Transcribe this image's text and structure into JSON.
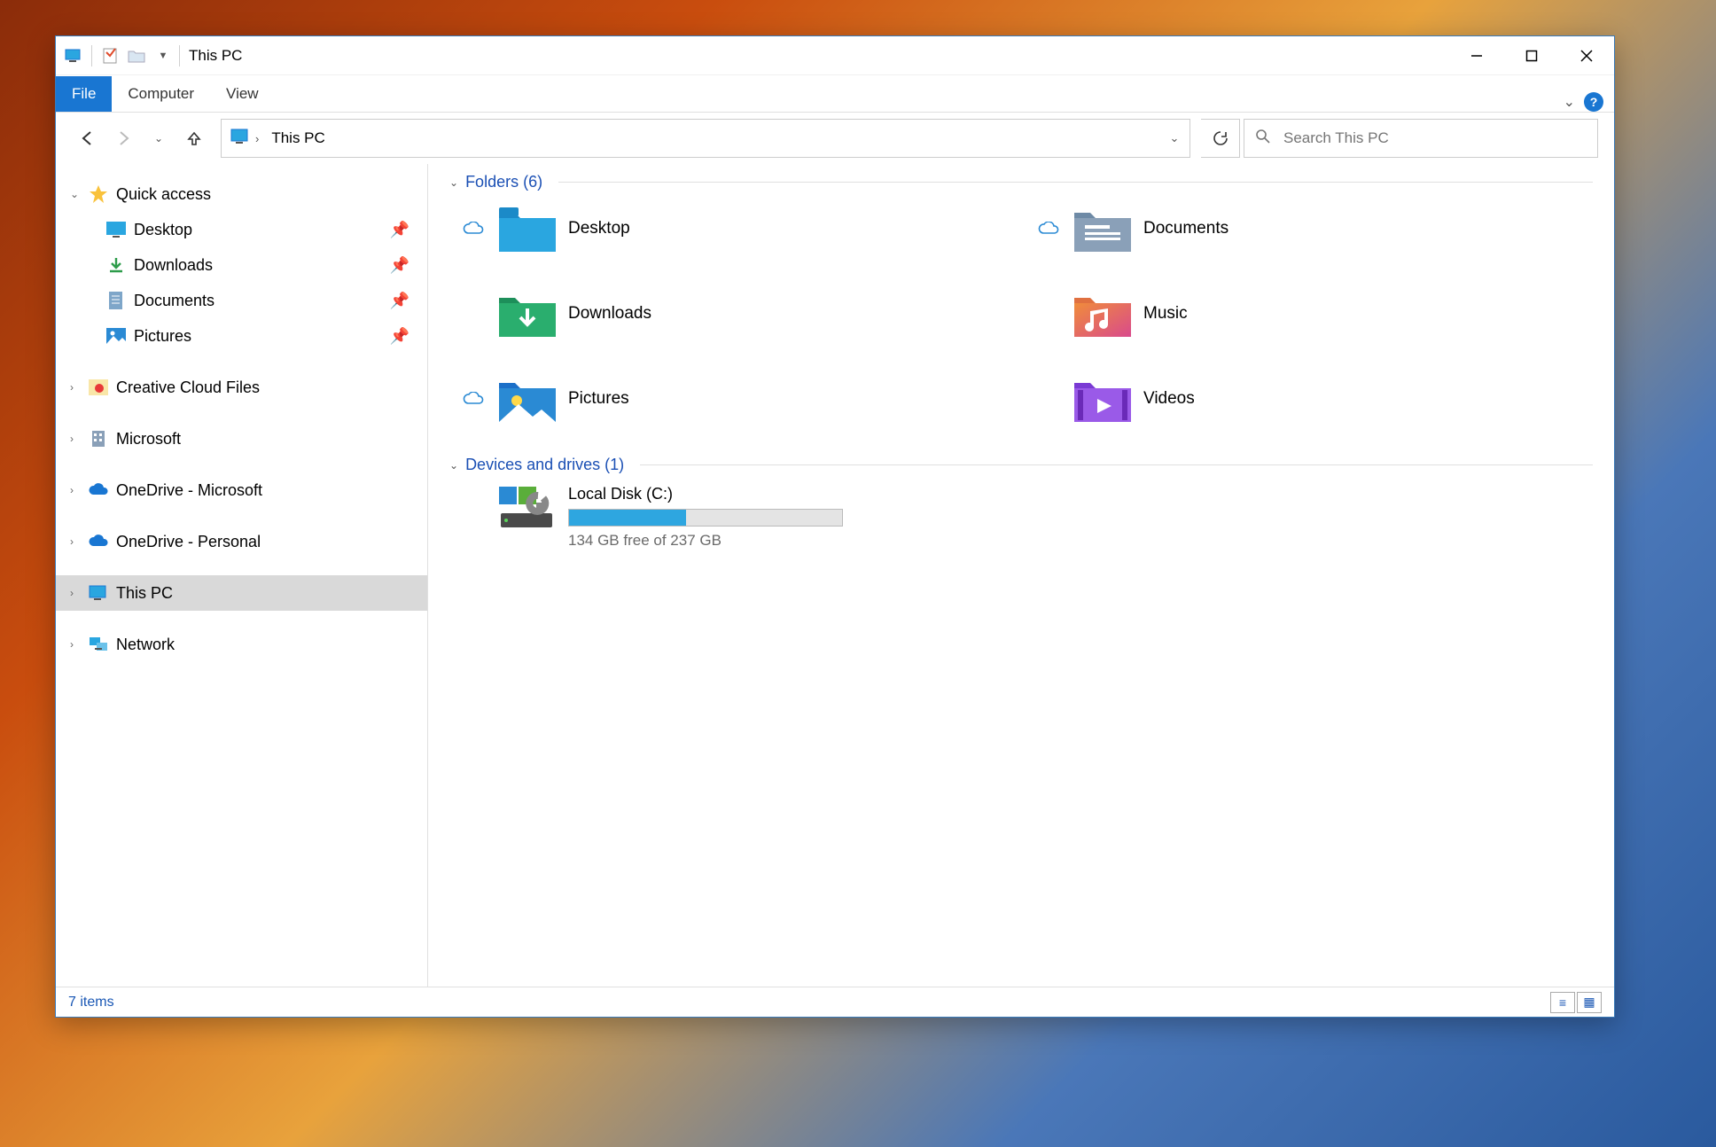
{
  "title": "This PC",
  "ribbon": {
    "file": "File",
    "computer": "Computer",
    "view": "View"
  },
  "addressbar": {
    "location": "This PC"
  },
  "search": {
    "placeholder": "Search This PC"
  },
  "tree": {
    "quick_access": "Quick access",
    "desktop": "Desktop",
    "downloads": "Downloads",
    "documents": "Documents",
    "pictures": "Pictures",
    "creative_cloud": "Creative Cloud Files",
    "microsoft": "Microsoft",
    "onedrive_ms": "OneDrive - Microsoft",
    "onedrive_personal": "OneDrive - Personal",
    "this_pc": "This PC",
    "network": "Network"
  },
  "groups": {
    "folders": "Folders (6)",
    "devices": "Devices and drives (1)"
  },
  "folders": {
    "desktop": {
      "label": "Desktop",
      "cloud": true
    },
    "documents": {
      "label": "Documents",
      "cloud": true
    },
    "downloads": {
      "label": "Downloads",
      "cloud": false
    },
    "music": {
      "label": "Music",
      "cloud": false
    },
    "pictures": {
      "label": "Pictures",
      "cloud": true
    },
    "videos": {
      "label": "Videos",
      "cloud": false
    }
  },
  "drive": {
    "name": "Local Disk (C:)",
    "sub": "134 GB free of 237 GB",
    "used_pct": 43
  },
  "status": {
    "items": "7 items"
  }
}
